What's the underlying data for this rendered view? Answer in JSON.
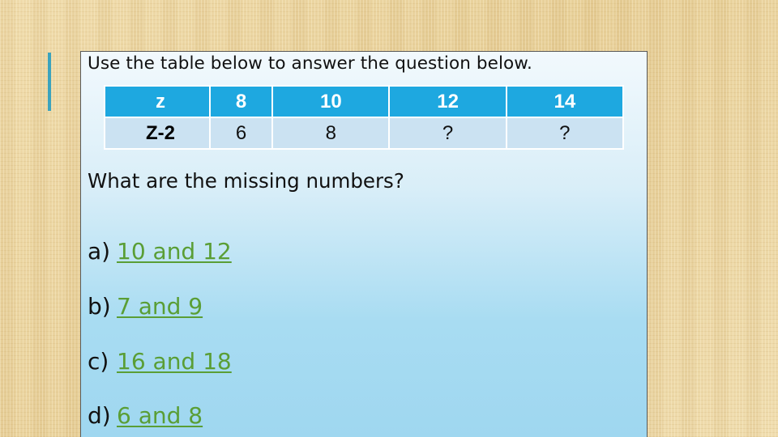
{
  "slide": {
    "instruction": "Use the table below to answer the question below.",
    "table": {
      "header": [
        "z",
        "8",
        "10",
        "12",
        "14"
      ],
      "row": [
        "Z-2",
        "6",
        "8",
        "?",
        "?"
      ]
    },
    "question": "What are the missing numbers?",
    "options": [
      {
        "letter": "a)",
        "answer": "10 and 12"
      },
      {
        "letter": "b)",
        "answer": "7 and 9"
      },
      {
        "letter": "c)",
        "answer": "16 and 18"
      },
      {
        "letter": "d)",
        "answer": "6 and 8"
      }
    ],
    "colors": {
      "accent_bar": "#3ba3bd",
      "table_header": "#1ea8e0",
      "table_row": "#cbe2f2",
      "answer_link": "#5a9e35"
    }
  }
}
